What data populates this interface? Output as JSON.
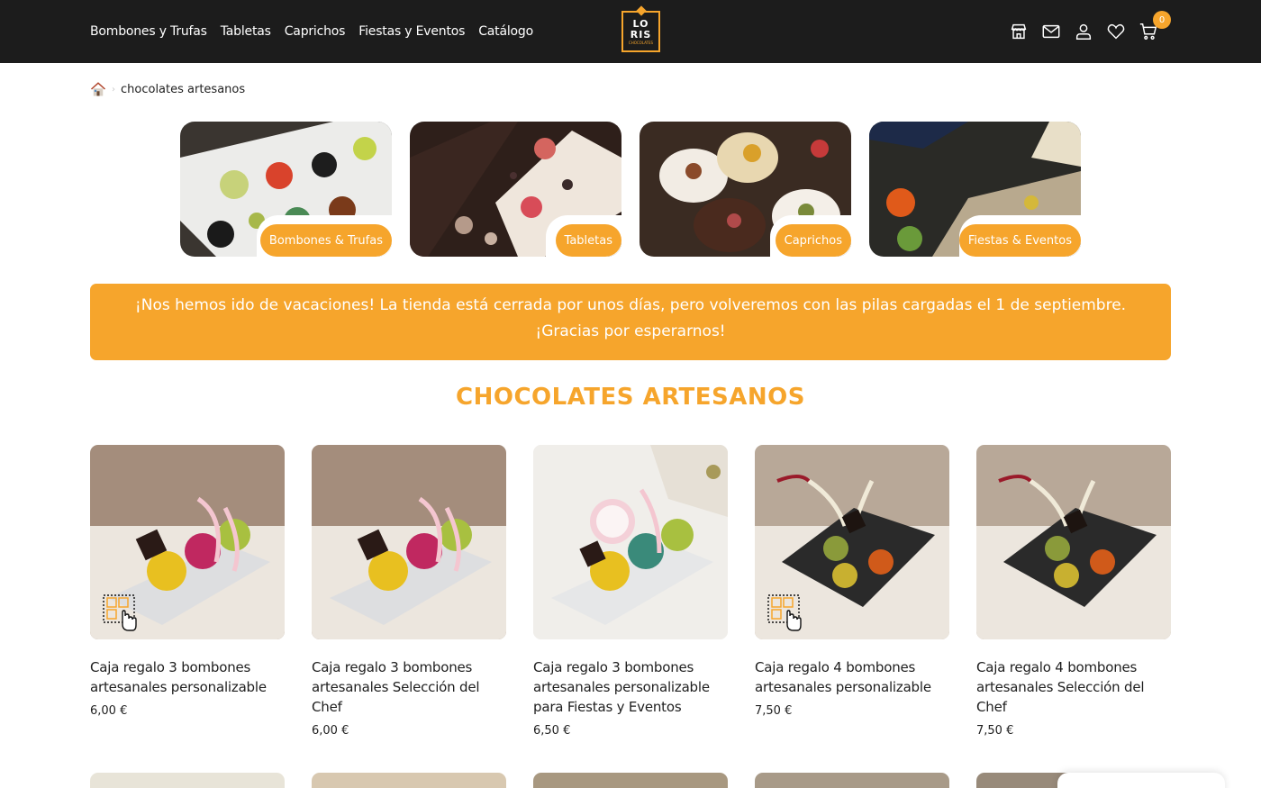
{
  "header": {
    "nav": [
      "Bombones y Trufas",
      "Tabletas",
      "Caprichos",
      "Fiestas y Eventos",
      "Catálogo"
    ],
    "logo": {
      "line1": "LO",
      "line2": "RIS",
      "tagline": "CHOCOLATES"
    },
    "icons": [
      "store-icon",
      "mail-icon",
      "user-icon",
      "heart-icon",
      "cart-icon"
    ],
    "cart_count": "0"
  },
  "breadcrumb": {
    "separator": "›",
    "current": "chocolates artesanos"
  },
  "categories": [
    {
      "label": "Bombones & Trufas"
    },
    {
      "label": "Tabletas"
    },
    {
      "label": "Caprichos"
    },
    {
      "label": "Fiestas & Eventos"
    }
  ],
  "notice": "¡Nos hemos ido de vacaciones! La tienda está cerrada por unos días, pero volveremos con las pilas cargadas el 1 de septiembre. ¡Gracias por esperarnos!",
  "section_title": "CHOCOLATES ARTESANOS",
  "products": [
    {
      "name": "Caja regalo 3 bombones artesanales personalizable",
      "price": "6,00 €"
    },
    {
      "name": "Caja regalo 3 bombones artesanales Selección del Chef",
      "price": "6,00 €"
    },
    {
      "name": "Caja regalo 3 bombones artesanales personalizable para Fiestas y Eventos",
      "price": "6,50 €"
    },
    {
      "name": "Caja regalo 4 bombones artesanales personalizable",
      "price": "7,50 €"
    },
    {
      "name": "Caja regalo 4 bombones artesanales Selección del Chef",
      "price": "7,50 €"
    }
  ],
  "colors": {
    "accent": "#f6a52c",
    "header_bg": "#1c1c1c"
  }
}
